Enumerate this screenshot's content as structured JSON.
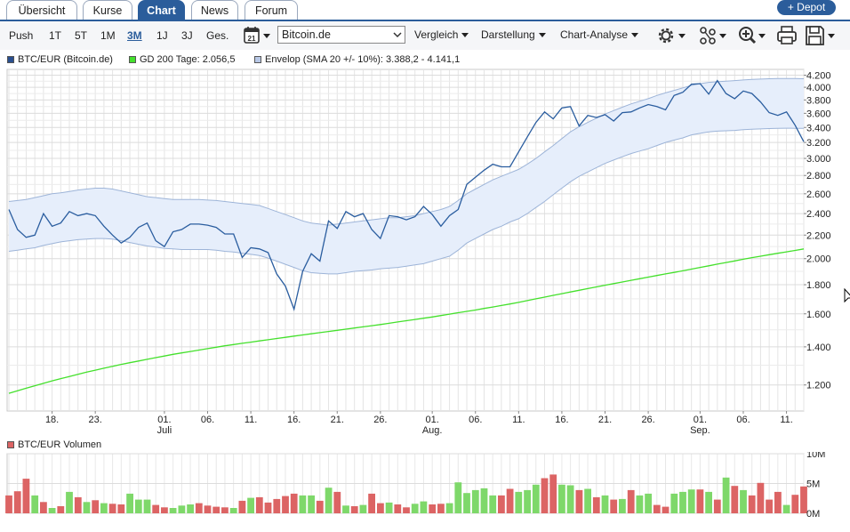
{
  "tabs": [
    {
      "label": "Übersicht"
    },
    {
      "label": "Kurse"
    },
    {
      "label": "Chart"
    },
    {
      "label": "News"
    },
    {
      "label": "Forum"
    }
  ],
  "depot_button": "+ Depot",
  "toolbar": {
    "periods": [
      "Push",
      "1T",
      "5T",
      "1M",
      "3M",
      "1J",
      "3J",
      "Ges."
    ],
    "active_period": "3M",
    "calendar_day": "21",
    "exchange_select": "Bitcoin.de",
    "menus": [
      "Vergleich",
      "Darstellung",
      "Chart-Analyse"
    ]
  },
  "legend": {
    "price": "BTC/EUR (Bitcoin.de)",
    "gd200": "GD 200 Tage: 2.056,5",
    "envelope": "Envelop (SMA 20 +/- 10%): 3.388,2 - 4.141,1",
    "volume": "BTC/EUR Volumen"
  },
  "colors": {
    "accent": "#2b5d9b",
    "price_line": "#2a5d9f",
    "gd200_line": "#44e02c",
    "envelope_fill": "#e6eefb",
    "envelope_line": "#9db4d8",
    "volume_up": "#7ed86a",
    "volume_down": "#dc6464"
  },
  "chart_data": {
    "type": "line",
    "scale": "log",
    "ylim": [
      1080,
      4300
    ],
    "y_ticks": [
      1200,
      1400,
      1600,
      1800,
      2000,
      2200,
      2400,
      2600,
      2800,
      3000,
      3200,
      3400,
      3600,
      3800,
      4000,
      4200
    ],
    "y_tick_labels": [
      "1.200",
      "1.400",
      "1.600",
      "1.800",
      "2.000",
      "2.200",
      "2.400",
      "2.600",
      "2.800",
      "3.000",
      "3.200",
      "3.400",
      "3.600",
      "3.800",
      "4.000",
      "4.200"
    ],
    "x_ticks": [
      {
        "day": 5,
        "label": "18."
      },
      {
        "day": 10,
        "label": "23."
      },
      {
        "day": 18,
        "label": "01.",
        "month": "Juli"
      },
      {
        "day": 23,
        "label": "06."
      },
      {
        "day": 28,
        "label": "11."
      },
      {
        "day": 33,
        "label": "16."
      },
      {
        "day": 38,
        "label": "21."
      },
      {
        "day": 43,
        "label": "26."
      },
      {
        "day": 49,
        "label": "01.",
        "month": "Aug."
      },
      {
        "day": 54,
        "label": "06."
      },
      {
        "day": 59,
        "label": "11."
      },
      {
        "day": 64,
        "label": "16."
      },
      {
        "day": 69,
        "label": "21."
      },
      {
        "day": 74,
        "label": "26."
      },
      {
        "day": 80,
        "label": "01.",
        "month": "Sep."
      },
      {
        "day": 85,
        "label": "06."
      },
      {
        "day": 90,
        "label": "11."
      }
    ],
    "days": 93,
    "series": [
      {
        "name": "BTC/EUR (Bitcoin.de)",
        "values": [
          2440,
          2250,
          2180,
          2200,
          2400,
          2280,
          2310,
          2420,
          2380,
          2400,
          2380,
          2280,
          2200,
          2130,
          2180,
          2270,
          2310,
          2150,
          2100,
          2230,
          2250,
          2300,
          2300,
          2290,
          2270,
          2210,
          2210,
          2010,
          2090,
          2080,
          2050,
          1880,
          1790,
          1630,
          1900,
          2040,
          1980,
          2330,
          2260,
          2420,
          2370,
          2400,
          2250,
          2170,
          2380,
          2370,
          2340,
          2370,
          2470,
          2390,
          2280,
          2380,
          2440,
          2700,
          2780,
          2860,
          2930,
          2900,
          2900,
          3080,
          3270,
          3470,
          3620,
          3520,
          3680,
          3700,
          3420,
          3570,
          3540,
          3580,
          3490,
          3610,
          3620,
          3680,
          3730,
          3700,
          3650,
          3870,
          3920,
          4050,
          4060,
          3890,
          4110,
          3900,
          3820,
          3940,
          3900,
          3770,
          3610,
          3570,
          3620,
          3430,
          3210
        ]
      },
      {
        "name": "GD 200 Tage",
        "values": [
          1160,
          1172,
          1184,
          1196,
          1208,
          1220,
          1231,
          1242,
          1253,
          1264,
          1274,
          1284,
          1294,
          1304,
          1313,
          1322,
          1331,
          1340,
          1349,
          1358,
          1366,
          1374,
          1382,
          1390,
          1398,
          1406,
          1413,
          1420,
          1427,
          1434,
          1441,
          1448,
          1455,
          1462,
          1469,
          1476,
          1483,
          1490,
          1497,
          1504,
          1511,
          1518,
          1525,
          1532,
          1540,
          1548,
          1556,
          1564,
          1572,
          1580,
          1589,
          1598,
          1607,
          1616,
          1625,
          1635,
          1645,
          1655,
          1665,
          1676,
          1688,
          1700,
          1712,
          1724,
          1736,
          1748,
          1760,
          1772,
          1784,
          1796,
          1808,
          1820,
          1832,
          1844,
          1856,
          1868,
          1880,
          1892,
          1904,
          1917,
          1930,
          1943,
          1956,
          1969,
          1982,
          1995,
          2008,
          2020,
          2032,
          2044,
          2056,
          2068,
          2080
        ]
      },
      {
        "name": "Envelop (SMA 20 +/- 10%) Oberband",
        "values": [
          2520,
          2530,
          2540,
          2560,
          2580,
          2600,
          2610,
          2625,
          2640,
          2650,
          2660,
          2660,
          2650,
          2630,
          2610,
          2590,
          2570,
          2560,
          2550,
          2540,
          2540,
          2540,
          2540,
          2535,
          2530,
          2520,
          2510,
          2500,
          2490,
          2480,
          2450,
          2420,
          2390,
          2360,
          2330,
          2310,
          2300,
          2290,
          2300,
          2310,
          2320,
          2330,
          2340,
          2350,
          2360,
          2360,
          2370,
          2380,
          2400,
          2420,
          2440,
          2470,
          2530,
          2600,
          2650,
          2700,
          2750,
          2790,
          2830,
          2870,
          2930,
          3000,
          3080,
          3160,
          3250,
          3340,
          3410,
          3470,
          3530,
          3590,
          3640,
          3690,
          3740,
          3780,
          3820,
          3870,
          3910,
          3950,
          3990,
          4030,
          4060,
          4080,
          4090,
          4100,
          4110,
          4120,
          4130,
          4135,
          4140,
          4145,
          4145,
          4143,
          4141
        ]
      },
      {
        "name": "Envelop (SMA 20 +/- 10%) Unterband",
        "values": [
          2060,
          2070,
          2080,
          2090,
          2110,
          2125,
          2140,
          2150,
          2160,
          2165,
          2170,
          2170,
          2165,
          2150,
          2135,
          2120,
          2105,
          2095,
          2085,
          2080,
          2075,
          2075,
          2075,
          2075,
          2070,
          2060,
          2055,
          2045,
          2035,
          2025,
          2005,
          1980,
          1955,
          1930,
          1905,
          1890,
          1885,
          1880,
          1880,
          1890,
          1900,
          1905,
          1910,
          1920,
          1925,
          1930,
          1940,
          1950,
          1960,
          1980,
          2000,
          2020,
          2070,
          2130,
          2170,
          2210,
          2250,
          2280,
          2320,
          2350,
          2400,
          2460,
          2520,
          2590,
          2660,
          2730,
          2790,
          2840,
          2890,
          2940,
          2980,
          3020,
          3060,
          3090,
          3120,
          3160,
          3200,
          3230,
          3260,
          3300,
          3320,
          3340,
          3350,
          3355,
          3360,
          3370,
          3375,
          3380,
          3385,
          3388,
          3390,
          3389,
          3388
        ]
      }
    ],
    "volume": {
      "name": "BTC/EUR Volumen",
      "y_ticks": [
        0,
        5,
        10
      ],
      "y_tick_labels": [
        "0M",
        "5M",
        "10M"
      ],
      "ylim": [
        0,
        10
      ],
      "values": [
        3.0,
        3.7,
        5.8,
        3.0,
        1.9,
        0.9,
        1.2,
        3.6,
        2.7,
        1.9,
        2.2,
        1.7,
        1.6,
        1.5,
        3.3,
        2.3,
        2.3,
        1.4,
        1.0,
        0.9,
        1.3,
        1.5,
        1.7,
        1.3,
        1.1,
        1.0,
        0.9,
        2.1,
        2.6,
        2.7,
        1.8,
        2.4,
        2.9,
        3.3,
        3.0,
        3.0,
        2.1,
        4.3,
        3.6,
        1.3,
        1.2,
        1.4,
        3.3,
        1.7,
        1.8,
        1.5,
        1.0,
        1.6,
        2.0,
        1.5,
        1.6,
        1.7,
        5.2,
        3.4,
        3.9,
        4.2,
        3.0,
        3.0,
        4.1,
        3.6,
        3.9,
        4.8,
        5.9,
        6.5,
        4.8,
        4.7,
        3.9,
        4.1,
        2.7,
        3.0,
        2.3,
        2.4,
        3.9,
        3.0,
        3.3,
        1.4,
        1.1,
        3.3,
        3.6,
        4.0,
        4.0,
        3.6,
        2.3,
        6.0,
        4.6,
        3.9,
        3.0,
        5.1,
        2.3,
        3.6,
        1.4,
        3.1,
        4.5
      ],
      "direction": [
        "d",
        "d",
        "d",
        "u",
        "d",
        "u",
        "d",
        "u",
        "d",
        "u",
        "d",
        "u",
        "d",
        "d",
        "u",
        "u",
        "u",
        "d",
        "d",
        "u",
        "u",
        "u",
        "d",
        "d",
        "d",
        "d",
        "u",
        "d",
        "u",
        "d",
        "d",
        "d",
        "d",
        "d",
        "u",
        "u",
        "d",
        "u",
        "d",
        "u",
        "d",
        "u",
        "d",
        "d",
        "u",
        "d",
        "d",
        "u",
        "u",
        "d",
        "d",
        "u",
        "u",
        "u",
        "u",
        "u",
        "u",
        "d",
        "d",
        "u",
        "u",
        "u",
        "d",
        "d",
        "u",
        "u",
        "d",
        "u",
        "d",
        "u",
        "d",
        "u",
        "d",
        "u",
        "u",
        "d",
        "d",
        "u",
        "u",
        "u",
        "d",
        "u",
        "d",
        "u",
        "d",
        "u",
        "d",
        "d",
        "d",
        "d",
        "u",
        "d",
        "d"
      ]
    }
  }
}
